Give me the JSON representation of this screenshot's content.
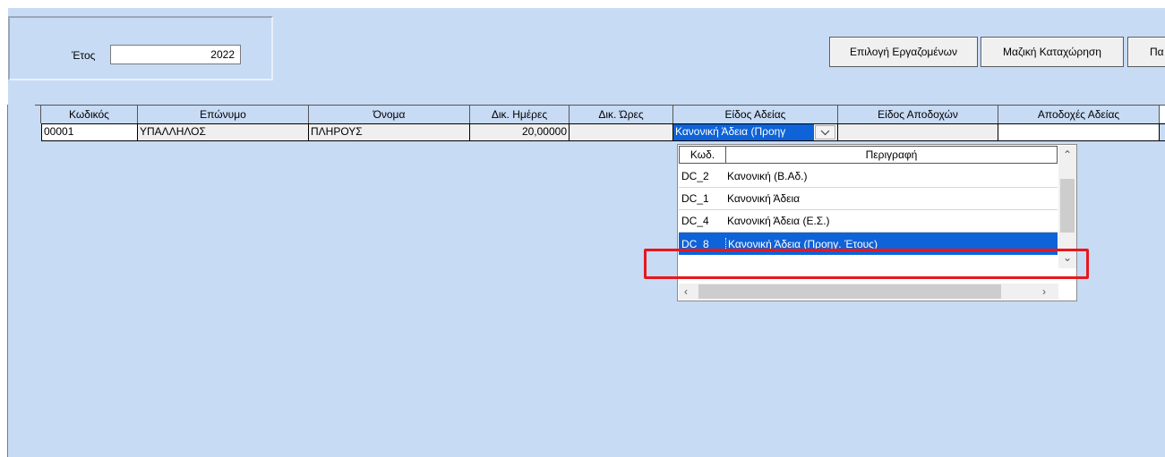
{
  "year": {
    "label": "Έτος",
    "value": "2022"
  },
  "buttons": {
    "select_employees": "Επιλογή Εργαζομένων",
    "bulk_entry": "Μαζική Καταχώρηση",
    "partial": "Πα"
  },
  "grid": {
    "headers": [
      "Κωδικός",
      "Επώνυμο",
      "Όνομα",
      "Δικ. Ημέρες",
      "Δικ. Ώρες",
      "Είδος Αδείας",
      "Είδος Αποδοχών",
      "Αποδοχές Αδείας"
    ],
    "row": {
      "code": "00001",
      "surname": "ΥΠΑΛΛΗΛΟΣ",
      "name": "ΠΛΗΡΟΥΣ",
      "days": "20,00000",
      "hours": "",
      "leave_type": "Κανονική Άδεια (Προηγ",
      "pay_type": "",
      "leave_pay": ""
    }
  },
  "dropdown": {
    "headers": {
      "code": "Κωδ.",
      "description": "Περιγραφή"
    },
    "items": [
      {
        "code": "DC_2",
        "description": "Κανονική (Β.Αδ.)"
      },
      {
        "code": "DC_1",
        "description": "Κανονική Άδεια"
      },
      {
        "code": "DC_4",
        "description": "Κανονική Άδεια (Ε.Σ.)"
      },
      {
        "code": "DC_8",
        "description": "Κανονική Άδεια (Προηγ. Έτους)"
      }
    ],
    "selected_code": "DC_8"
  },
  "colors": {
    "background": "#c8dbf5",
    "selection": "#0d63d7",
    "highlight": "#e8171c"
  }
}
